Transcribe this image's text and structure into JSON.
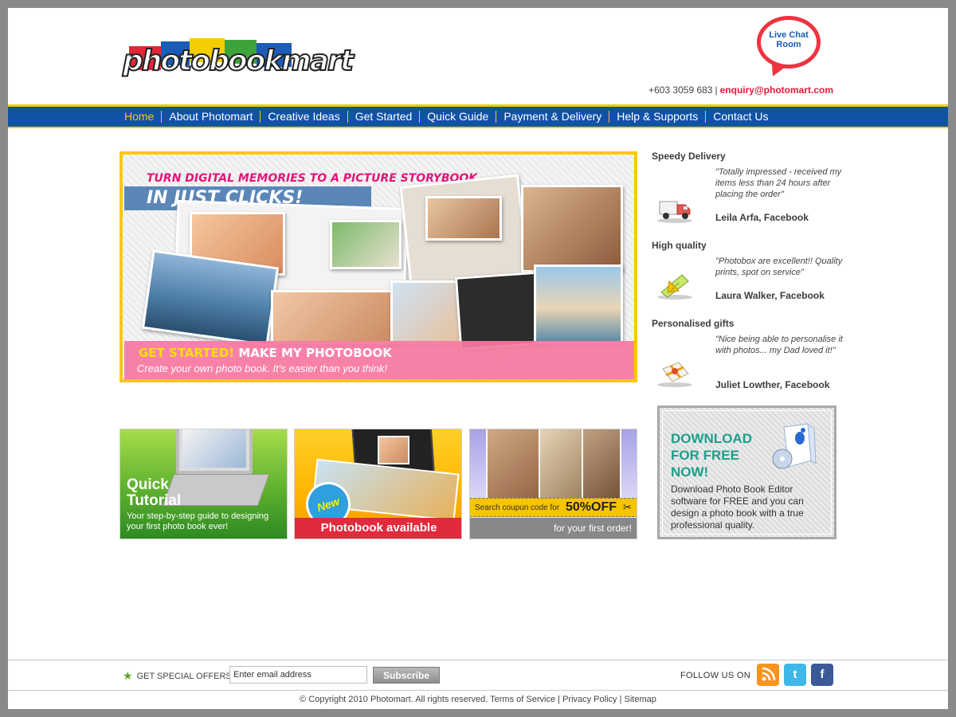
{
  "header": {
    "logo_text": "photobookmart",
    "live_chat": [
      "Live Chat",
      "Room"
    ],
    "phone": "+603 3059 683",
    "separator": "|",
    "email": "enquiry@photomart.com"
  },
  "nav": {
    "items": [
      {
        "label": "Home",
        "active": true
      },
      {
        "label": "About Photomart"
      },
      {
        "label": "Creative Ideas"
      },
      {
        "label": "Get Started"
      },
      {
        "label": "Quick Guide"
      },
      {
        "label": "Payment & Delivery"
      },
      {
        "label": "Help & Supports"
      },
      {
        "label": "Contact Us"
      }
    ]
  },
  "hero": {
    "line1": "TURN DIGITAL MEMORIES TO A PICTURE STORYBOOK,",
    "line2": "IN JUST CLICKS!",
    "cta_a": "GET STARTED!",
    "cta_b": "MAKE MY PHOTOBOOK",
    "subtitle": "Create your own photo book. It's easier than you think!"
  },
  "testimonials": [
    {
      "heading": "Speedy Delivery",
      "quote": "\"Totally impressed - received my items less than 24 hours after placing the order\"",
      "author": "Leila Arfa, Facebook",
      "icon": "delivery-truck-icon"
    },
    {
      "heading": "High quality",
      "quote": "\"Photobox are excellent!! Quality prints, spot on service\"",
      "author": "Laura Walker, Facebook",
      "icon": "ruler-quality-icon"
    },
    {
      "heading": "Personalised gifts",
      "quote": "\"Nice being able to personalise it with photos... my Dad loved it!\"",
      "author": "Juliet Lowther, Facebook",
      "icon": "gift-icon"
    }
  ],
  "tiles": {
    "tutorial_title": [
      "Quick",
      "Tutorial"
    ],
    "tutorial_desc": "Your step-by-step guide to designing your first photo book ever!",
    "new_badge": "New",
    "photobook_label": "Photobook available",
    "coupon_text": "Search coupun code for",
    "coupon_value": "50%OFF",
    "coupon_icon": "scissors-icon",
    "coupon_sub": "for your first order!"
  },
  "download": {
    "title": [
      "DOWNLOAD",
      "FOR FREE",
      "NOW!"
    ],
    "desc": "Download Photo Book Editor software for FREE and you can design a photo book with a true professional quality."
  },
  "footer": {
    "offers_label": "GET SPECIAL OFFERS",
    "email_placeholder": "Enter email address",
    "subscribe_label": "Subscribe",
    "follow_label": "FOLLOW US ON",
    "social": [
      {
        "icon": "rss-icon",
        "color": "#f7941d"
      },
      {
        "icon": "twitter-icon",
        "color": "#3fb7e8"
      },
      {
        "icon": "facebook-icon",
        "color": "#3b5998"
      }
    ],
    "copyright": "© Copyright 2010 Photomart. All rights reserved.",
    "links": [
      "Terms of Service",
      "Privacy Policy",
      "Sitemap"
    ],
    "link_separator": "|"
  },
  "colors": {
    "nav_bg": "#1053a5",
    "accent_yellow": "#f6cd00",
    "brand_red": "#e8173b",
    "teal": "#1aa08c"
  }
}
